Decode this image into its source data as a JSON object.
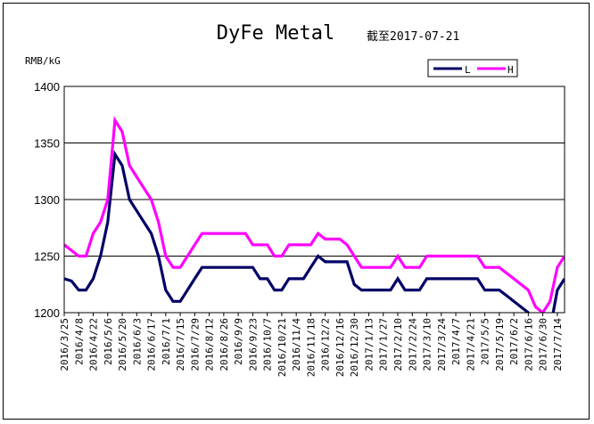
{
  "chart_data": {
    "type": "line",
    "title": "DyFe Metal",
    "subtitle": "截至2017-07-21",
    "ylabel": "RMB/kG",
    "xlabel": "",
    "ylim": [
      1200,
      1400
    ],
    "yticks": [
      1200,
      1250,
      1300,
      1350,
      1400
    ],
    "grid": "horizontal",
    "legend_position": "top-right",
    "x_tick_labels": [
      "2016/3/25",
      "2016/4/8",
      "2016/4/22",
      "2016/5/6",
      "2016/5/20",
      "2016/6/3",
      "2016/6/17",
      "2016/7/1",
      "2016/7/15",
      "2016/7/29",
      "2016/8/12",
      "2016/8/26",
      "2016/9/9",
      "2016/9/23",
      "2016/10/7",
      "2016/10/21",
      "2016/11/4",
      "2016/11/18",
      "2016/12/2",
      "2016/12/16",
      "2016/12/30",
      "2017/1/13",
      "2017/1/27",
      "2017/2/10",
      "2017/2/24",
      "2017/3/10",
      "2017/3/24",
      "2017/4/7",
      "2017/4/21",
      "2017/5/5",
      "2017/5/19",
      "2017/6/2",
      "2017/6/16",
      "2017/6/30",
      "2017/7/14"
    ],
    "x": [
      "2016/3/25",
      "2016/4/1",
      "2016/4/8",
      "2016/4/15",
      "2016/4/22",
      "2016/4/29",
      "2016/5/6",
      "2016/5/13",
      "2016/5/20",
      "2016/5/27",
      "2016/6/3",
      "2016/6/10",
      "2016/6/17",
      "2016/6/24",
      "2016/7/1",
      "2016/7/8",
      "2016/7/15",
      "2016/7/22",
      "2016/7/29",
      "2016/8/5",
      "2016/8/12",
      "2016/8/19",
      "2016/8/26",
      "2016/9/2",
      "2016/9/9",
      "2016/9/16",
      "2016/9/23",
      "2016/9/30",
      "2016/10/7",
      "2016/10/14",
      "2016/10/21",
      "2016/10/28",
      "2016/11/4",
      "2016/11/11",
      "2016/11/18",
      "2016/11/25",
      "2016/12/2",
      "2016/12/9",
      "2016/12/16",
      "2016/12/23",
      "2016/12/30",
      "2017/1/6",
      "2017/1/13",
      "2017/1/20",
      "2017/1/27",
      "2017/2/3",
      "2017/2/10",
      "2017/2/17",
      "2017/2/24",
      "2017/3/3",
      "2017/3/10",
      "2017/3/17",
      "2017/3/24",
      "2017/3/31",
      "2017/4/7",
      "2017/4/14",
      "2017/4/21",
      "2017/4/28",
      "2017/5/5",
      "2017/5/12",
      "2017/5/19",
      "2017/5/26",
      "2017/6/2",
      "2017/6/9",
      "2017/6/16",
      "2017/6/23",
      "2017/6/30",
      "2017/7/7",
      "2017/7/14",
      "2017/7/21"
    ],
    "series": [
      {
        "name": "L",
        "color": "#000066",
        "values": [
          1230,
          1228,
          1220,
          1220,
          1230,
          1250,
          1280,
          1340,
          1330,
          1300,
          1290,
          1280,
          1270,
          1250,
          1220,
          1210,
          1210,
          1220,
          1230,
          1240,
          1240,
          1240,
          1240,
          1240,
          1240,
          1240,
          1240,
          1230,
          1230,
          1220,
          1220,
          1230,
          1230,
          1230,
          1240,
          1250,
          1245,
          1245,
          1245,
          1245,
          1225,
          1220,
          1220,
          1220,
          1220,
          1220,
          1230,
          1220,
          1220,
          1220,
          1230,
          1230,
          1230,
          1230,
          1230,
          1230,
          1230,
          1230,
          1220,
          1220,
          1220,
          1215,
          1210,
          1205,
          1200,
          1190,
          1180,
          1185,
          1220,
          1230
        ]
      },
      {
        "name": "H",
        "color": "#ff00ff",
        "values": [
          1260,
          1255,
          1250,
          1250,
          1270,
          1280,
          1300,
          1370,
          1360,
          1330,
          1320,
          1310,
          1300,
          1280,
          1250,
          1240,
          1240,
          1250,
          1260,
          1270,
          1270,
          1270,
          1270,
          1270,
          1270,
          1270,
          1260,
          1260,
          1260,
          1250,
          1250,
          1260,
          1260,
          1260,
          1260,
          1270,
          1265,
          1265,
          1265,
          1260,
          1250,
          1240,
          1240,
          1240,
          1240,
          1240,
          1250,
          1240,
          1240,
          1240,
          1250,
          1250,
          1250,
          1250,
          1250,
          1250,
          1250,
          1250,
          1240,
          1240,
          1240,
          1235,
          1230,
          1225,
          1220,
          1205,
          1200,
          1210,
          1240,
          1250
        ]
      }
    ]
  }
}
